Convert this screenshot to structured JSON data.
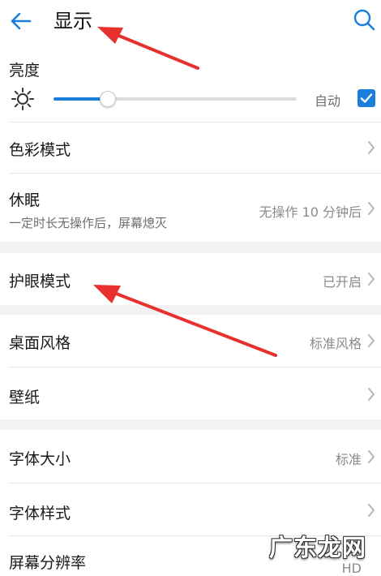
{
  "header": {
    "title": "显示"
  },
  "brightness": {
    "label": "亮度",
    "auto_label": "自动",
    "level": 0.22,
    "auto_checked": true
  },
  "items": [
    {
      "label": "色彩模式"
    },
    {
      "label": "休眠",
      "subtitle": "一定时长无操作后，屏幕熄灭",
      "value": "无操作 10 分钟后"
    },
    {
      "label": "护眼模式",
      "value": "已开启"
    },
    {
      "label": "桌面风格",
      "value": "标准风格"
    },
    {
      "label": "壁纸"
    },
    {
      "label": "字体大小",
      "value": "标准"
    },
    {
      "label": "字体样式"
    },
    {
      "label": "屏幕分辨率",
      "value": "HD"
    }
  ],
  "watermark": {
    "text": "广东龙网"
  },
  "colors": {
    "accent": "#1a7fdc",
    "annotation_arrow": "#e8312f"
  }
}
